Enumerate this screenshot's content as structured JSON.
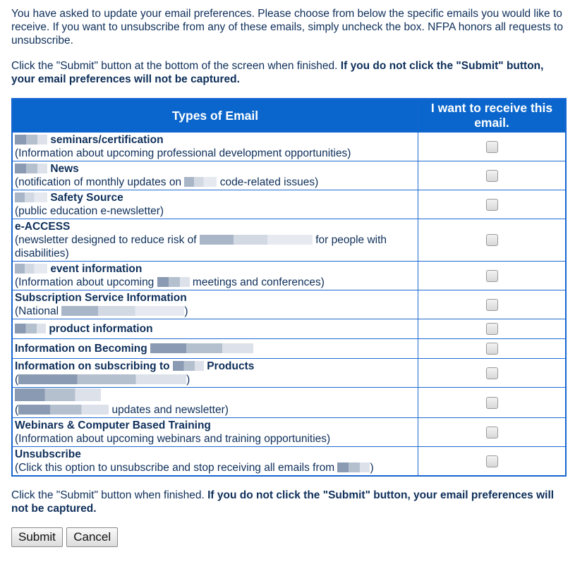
{
  "intro": {
    "paragraph1": "You have asked to update your email preferences. Please choose from below the specific emails you would like to receive. If you want to unsubscribe from any of these emails, simply uncheck the box. NFPA honors all requests to unsubscribe.",
    "paragraph2_plain": "Click the \"Submit\" button at the bottom of the screen when finished. ",
    "paragraph2_bold": "If you do not click the \"Submit\" button, your email preferences will not be captured."
  },
  "table": {
    "headers": [
      "Types of Email",
      "I want to receive this email."
    ],
    "rows": [
      {
        "title_prefix_redacted": true,
        "title": "seminars/certification",
        "desc": "(Information about upcoming professional development opportunities)",
        "checked": false
      },
      {
        "title_prefix_redacted": true,
        "title": "News",
        "desc_before": "(notification of monthly updates on ",
        "desc_after": " code-related issues)",
        "checked": false
      },
      {
        "title_prefix_redacted": true,
        "title": "Safety Source",
        "desc": "(public education e-newsletter)",
        "checked": false
      },
      {
        "title": "e-ACCESS",
        "desc_before": "(newsletter designed to reduce risk of ",
        "desc_after": " for people with disabilities)",
        "checked": false
      },
      {
        "title_prefix_redacted": true,
        "title": "event information",
        "desc_before": "(Information about upcoming ",
        "desc_after": " meetings and conferences)",
        "checked": false
      },
      {
        "title": "Subscription Service Information",
        "desc_before": "(National ",
        "desc_after": ")",
        "checked": false
      },
      {
        "title_prefix_redacted": true,
        "title": "product information",
        "checked": false
      },
      {
        "title": "Information on Becoming ",
        "checked": false
      },
      {
        "title_before": "Information on subscribing to ",
        "title_after": " Products",
        "desc_before": "(",
        "desc_after": ")",
        "checked": false
      },
      {
        "title_redacted": true,
        "desc_before": "(",
        "desc_after": " updates and newsletter)",
        "checked": false
      },
      {
        "title": "Webinars & Computer Based Training",
        "desc": "(Information about upcoming webinars and training opportunities)",
        "checked": false
      },
      {
        "title": "Unsubscribe",
        "desc_before": "(Click this option to unsubscribe and stop receiving all emails from ",
        "desc_after": ")",
        "checked": false
      }
    ]
  },
  "footer": {
    "plain": "Click the \"Submit\" button when finished. ",
    "bold": "If you do not click the \"Submit\" button, your email preferences will not be captured."
  },
  "buttons": {
    "submit": "Submit",
    "cancel": "Cancel"
  }
}
